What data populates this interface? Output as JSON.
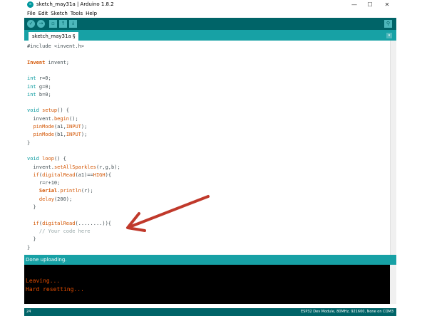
{
  "window": {
    "title": "sketch_may31a | Arduino 1.8.2",
    "app_logo_text": "∞",
    "controls": {
      "minimize": "—",
      "maximize": "☐",
      "close": "✕"
    }
  },
  "menu": [
    "File",
    "Edit",
    "Sketch",
    "Tools",
    "Help"
  ],
  "toolbar": {
    "buttons": [
      {
        "name": "verify",
        "icon": "check-icon",
        "glyph": "✓"
      },
      {
        "name": "upload",
        "icon": "arrow-right-icon",
        "glyph": "→"
      },
      {
        "name": "new",
        "icon": "new-file-icon",
        "glyph": "▫"
      },
      {
        "name": "open",
        "icon": "arrow-up-icon",
        "glyph": "↑"
      },
      {
        "name": "save",
        "icon": "arrow-down-icon",
        "glyph": "↓"
      }
    ],
    "serial_monitor_glyph": "⚲"
  },
  "tab": {
    "label": "sketch_may31a §",
    "menu_glyph": "▾"
  },
  "code": [
    "#include <invent.h>",
    "",
    "Invent invent;",
    "",
    "int r=0;",
    "int g=0;",
    "int b=0;",
    "",
    "void setup() {",
    "  invent.begin();",
    "  pinMode(a1,INPUT);",
    "  pinMode(b1,INPUT);",
    "}",
    "",
    "void loop() {",
    "  invent.setAllSparkles(r,g,b);",
    "  if(digitalRead(a1)==HIGH){",
    "    r=r+10;",
    "    Serial.println(r);",
    "    delay(200);",
    "  }",
    "",
    "  if(digitalRead(........)){",
    "    // Your code here",
    "  }",
    "}"
  ],
  "status": {
    "message": "Done uploading."
  },
  "console": {
    "lines": [
      "Leaving...",
      "Hard resetting..."
    ]
  },
  "footer": {
    "line_number": "24",
    "board": "ESP32 Dev Module, 80MHz, 921600, None on COM3"
  },
  "colors": {
    "toolbar": "#006468",
    "tabbar": "#17a1a5",
    "console_text": "#e34c00",
    "annotation_arrow": "#c0392b"
  }
}
